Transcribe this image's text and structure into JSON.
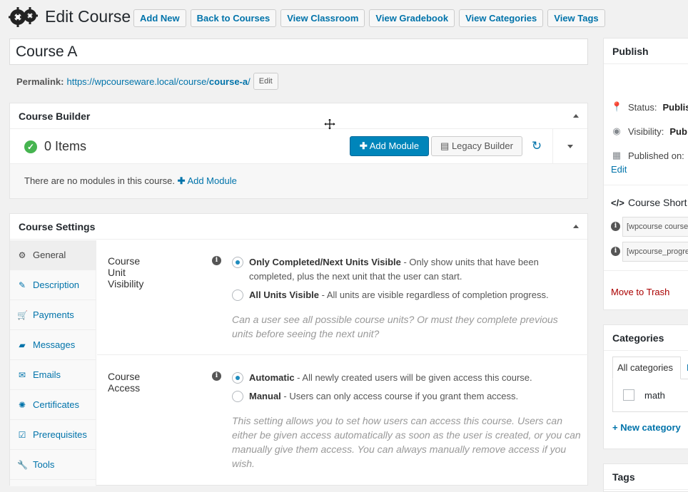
{
  "header": {
    "title": "Edit Course",
    "buttons": [
      "Add New",
      "Back to Courses",
      "View Classroom",
      "View Gradebook",
      "View Categories",
      "View Tags"
    ]
  },
  "post": {
    "title": "Course A",
    "permalink_label": "Permalink:",
    "permalink_base": "https://wpcourseware.local/course/",
    "permalink_slug": "course-a",
    "permalink_trailing": "/",
    "permalink_edit": "Edit"
  },
  "builder": {
    "heading": "Course Builder",
    "items_count": "0 Items",
    "add_module": "Add Module",
    "legacy_builder": "Legacy Builder",
    "empty_text": "There are no modules in this course.",
    "empty_link": "Add Module"
  },
  "settings": {
    "heading": "Course Settings",
    "tabs": [
      "General",
      "Description",
      "Payments",
      "Messages",
      "Emails",
      "Certificates",
      "Prerequisites",
      "Tools"
    ],
    "unit_visibility": {
      "label": "Course Unit Visibility",
      "opt1_title": "Only Completed/Next Units Visible",
      "opt1_desc": " - Only show units that have been completed, plus the next unit that the user can start.",
      "opt2_title": "All Units Visible",
      "opt2_desc": " - All units are visible regardless of completion progress.",
      "help": "Can a user see all possible course units? Or must they complete previous units before seeing the next unit?"
    },
    "access": {
      "label": "Course Access",
      "opt1_title": "Automatic",
      "opt1_desc": " - All newly created users will be given access this course.",
      "opt2_title": "Manual",
      "opt2_desc": " - Users can only access course if you grant them access.",
      "help": "This setting allows you to set how users can access this course. Users can either be given access automatically as soon as the user is created, or you can manually give them access. You can always manually remove access if you wish."
    }
  },
  "publish": {
    "heading": "Publish",
    "status_label": "Status:",
    "status_value": "Publis",
    "visibility_label": "Visibility:",
    "visibility_value": "Pub",
    "published_label": "Published on:",
    "edit": "Edit",
    "shortcode_heading": "Course Short",
    "shortcode1": "[wpcourse course",
    "shortcode2": "[wpcourse_progre",
    "trash": "Move to Trash"
  },
  "categories": {
    "heading": "Categories",
    "tab_all": "All categories",
    "tab_most_used_initial": "M",
    "items": [
      "math"
    ],
    "new_category": "+ New category"
  },
  "tags": {
    "heading": "Tags"
  },
  "colors": {
    "primary": "#0085ba",
    "link": "#0073aa",
    "success": "#46b450",
    "trash": "#a00"
  }
}
